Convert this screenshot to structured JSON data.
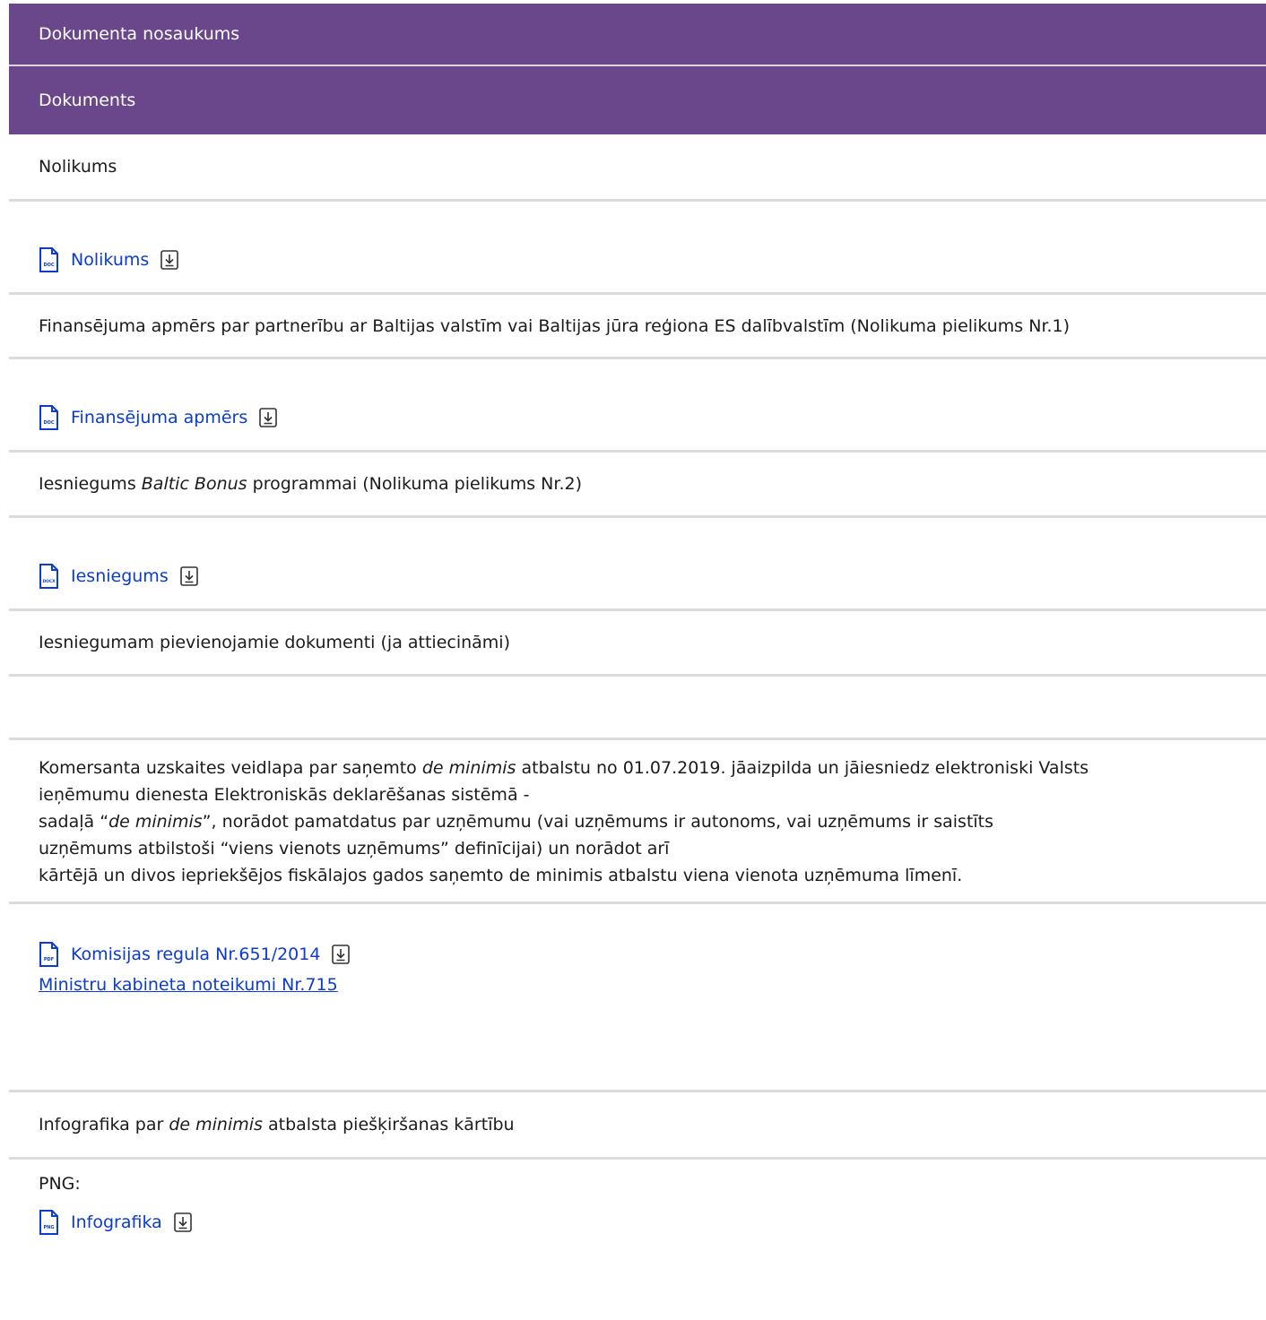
{
  "header": {
    "col_name": "Dokumenta nosaukums",
    "col_doc": "Dokuments"
  },
  "rows": {
    "r1_title": "Nolikums",
    "r1_file": {
      "label": "Nolikums",
      "type": "DOC"
    },
    "r2_title": "Finansējuma apmērs par partnerību ar Baltijas valstīm vai Baltijas jūra reģiona ES dalībvalstīm (Nolikuma pielikums Nr.1)",
    "r2_file": {
      "label": "Finansējuma apmērs",
      "type": "DOC"
    },
    "r3_title_pre": "Iesniegums ",
    "r3_title_em": "Baltic Bonus",
    "r3_title_post": " programmai (Nolikuma pielikums Nr.2)",
    "r3_file": {
      "label": "Iesniegums",
      "type": "DOCX"
    },
    "r4_title": "Iesniegumam pievienojamie dokumenti (ja attiecināmi)",
    "r5": {
      "l1_pre": "Komersanta uzskaites veidlapa par saņemto ",
      "l1_em": "de minimis",
      "l1_post": " atbalstu no 01.07.2019. jāaizpilda un jāiesniedz elektroniski Valsts",
      "l2": "ieņēmumu dienesta Elektroniskās deklarēšanas sistēmā -",
      "l3_pre": "sadaļā “",
      "l3_em": "de minimis",
      "l3_post": "”, norādot pamatdatus par uzņēmumu (vai uzņēmums ir autonoms, vai uzņēmums ir saistīts",
      "l4": "uzņēmums atbilstoši “viens vienots uzņēmums” definīcijai) un norādot arī",
      "l5": "kārtējā un divos iepriekšējos fiskālajos gados saņemto de minimis atbalstu viena vienota uzņēmuma līmenī."
    },
    "r6_file": {
      "label": "Komisijas regula Nr.651/2014",
      "type": "PDF"
    },
    "r6_link": "Ministru kabineta noteikumi Nr.715",
    "r7_title_pre": "Infografika par ",
    "r7_title_em": "de minimis",
    "r7_title_post": " atbalsta piešķiršanas kārtību",
    "r8_label": "PNG:",
    "r8_file": {
      "label": "Infografika",
      "type": "PNG"
    }
  },
  "colors": {
    "header_bg": "#6a478b",
    "link": "#0b3bd1",
    "divider": "#dcdcdc"
  },
  "icons": {
    "file": "file-icon",
    "download": "download-icon"
  }
}
